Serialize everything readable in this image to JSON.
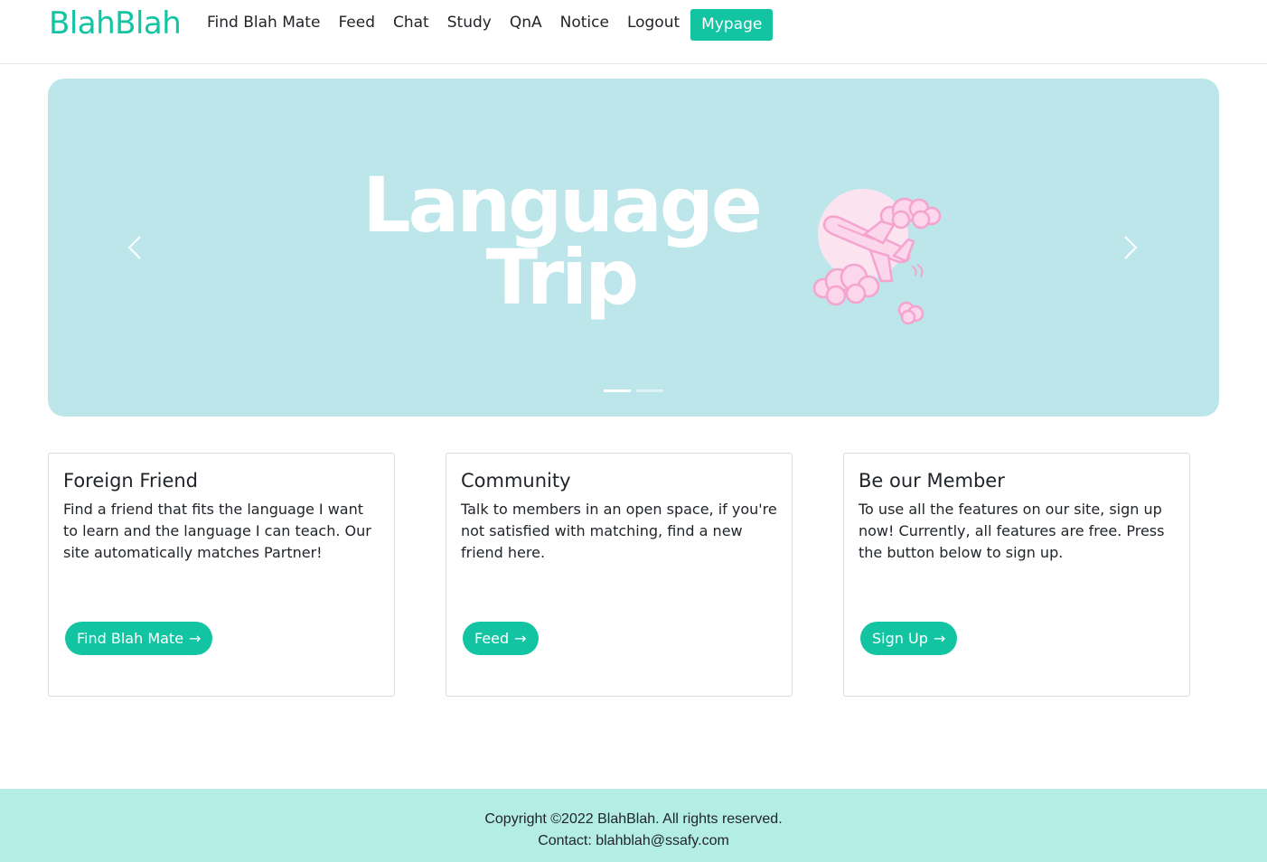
{
  "header": {
    "brand": "BlahBlah",
    "nav": [
      {
        "label": "Find Blah Mate"
      },
      {
        "label": "Feed"
      },
      {
        "label": "Chat"
      },
      {
        "label": "Study"
      },
      {
        "label": "QnA"
      },
      {
        "label": "Notice"
      },
      {
        "label": "Logout"
      }
    ],
    "mypage_label": "Mypage"
  },
  "carousel": {
    "title_line1": "Language",
    "title_line2": "Trip",
    "prev_icon": "chevron-left-icon",
    "next_icon": "chevron-right-icon",
    "slide_count": 2,
    "active_slide": 1
  },
  "cards": [
    {
      "title": "Foreign Friend",
      "text": "Find a friend that fits the language I want to learn and the language I can teach. Our site automatically matches Partner!",
      "button": "Find Blah Mate",
      "arrow": "→"
    },
    {
      "title": "Community",
      "text": "Talk to members in an open space, if you're not satisfied with matching, find a new friend here.",
      "button": "Feed",
      "arrow": "→"
    },
    {
      "title": "Be our Member",
      "text": "To use all the features on our site, sign up now! Currently, all features are free. Press the button below to sign up.",
      "button": "Sign Up",
      "arrow": "→"
    }
  ],
  "footer": {
    "copyright": "Copyright ©2022 BlahBlah. All rights reserved.",
    "contact": "Contact: blahblah@ssafy.com"
  },
  "colors": {
    "accent": "#13c4a3",
    "hero_bg": "#bde6ea",
    "footer_bg": "#b3ede4",
    "plane_pink": "#f5a3cf"
  }
}
